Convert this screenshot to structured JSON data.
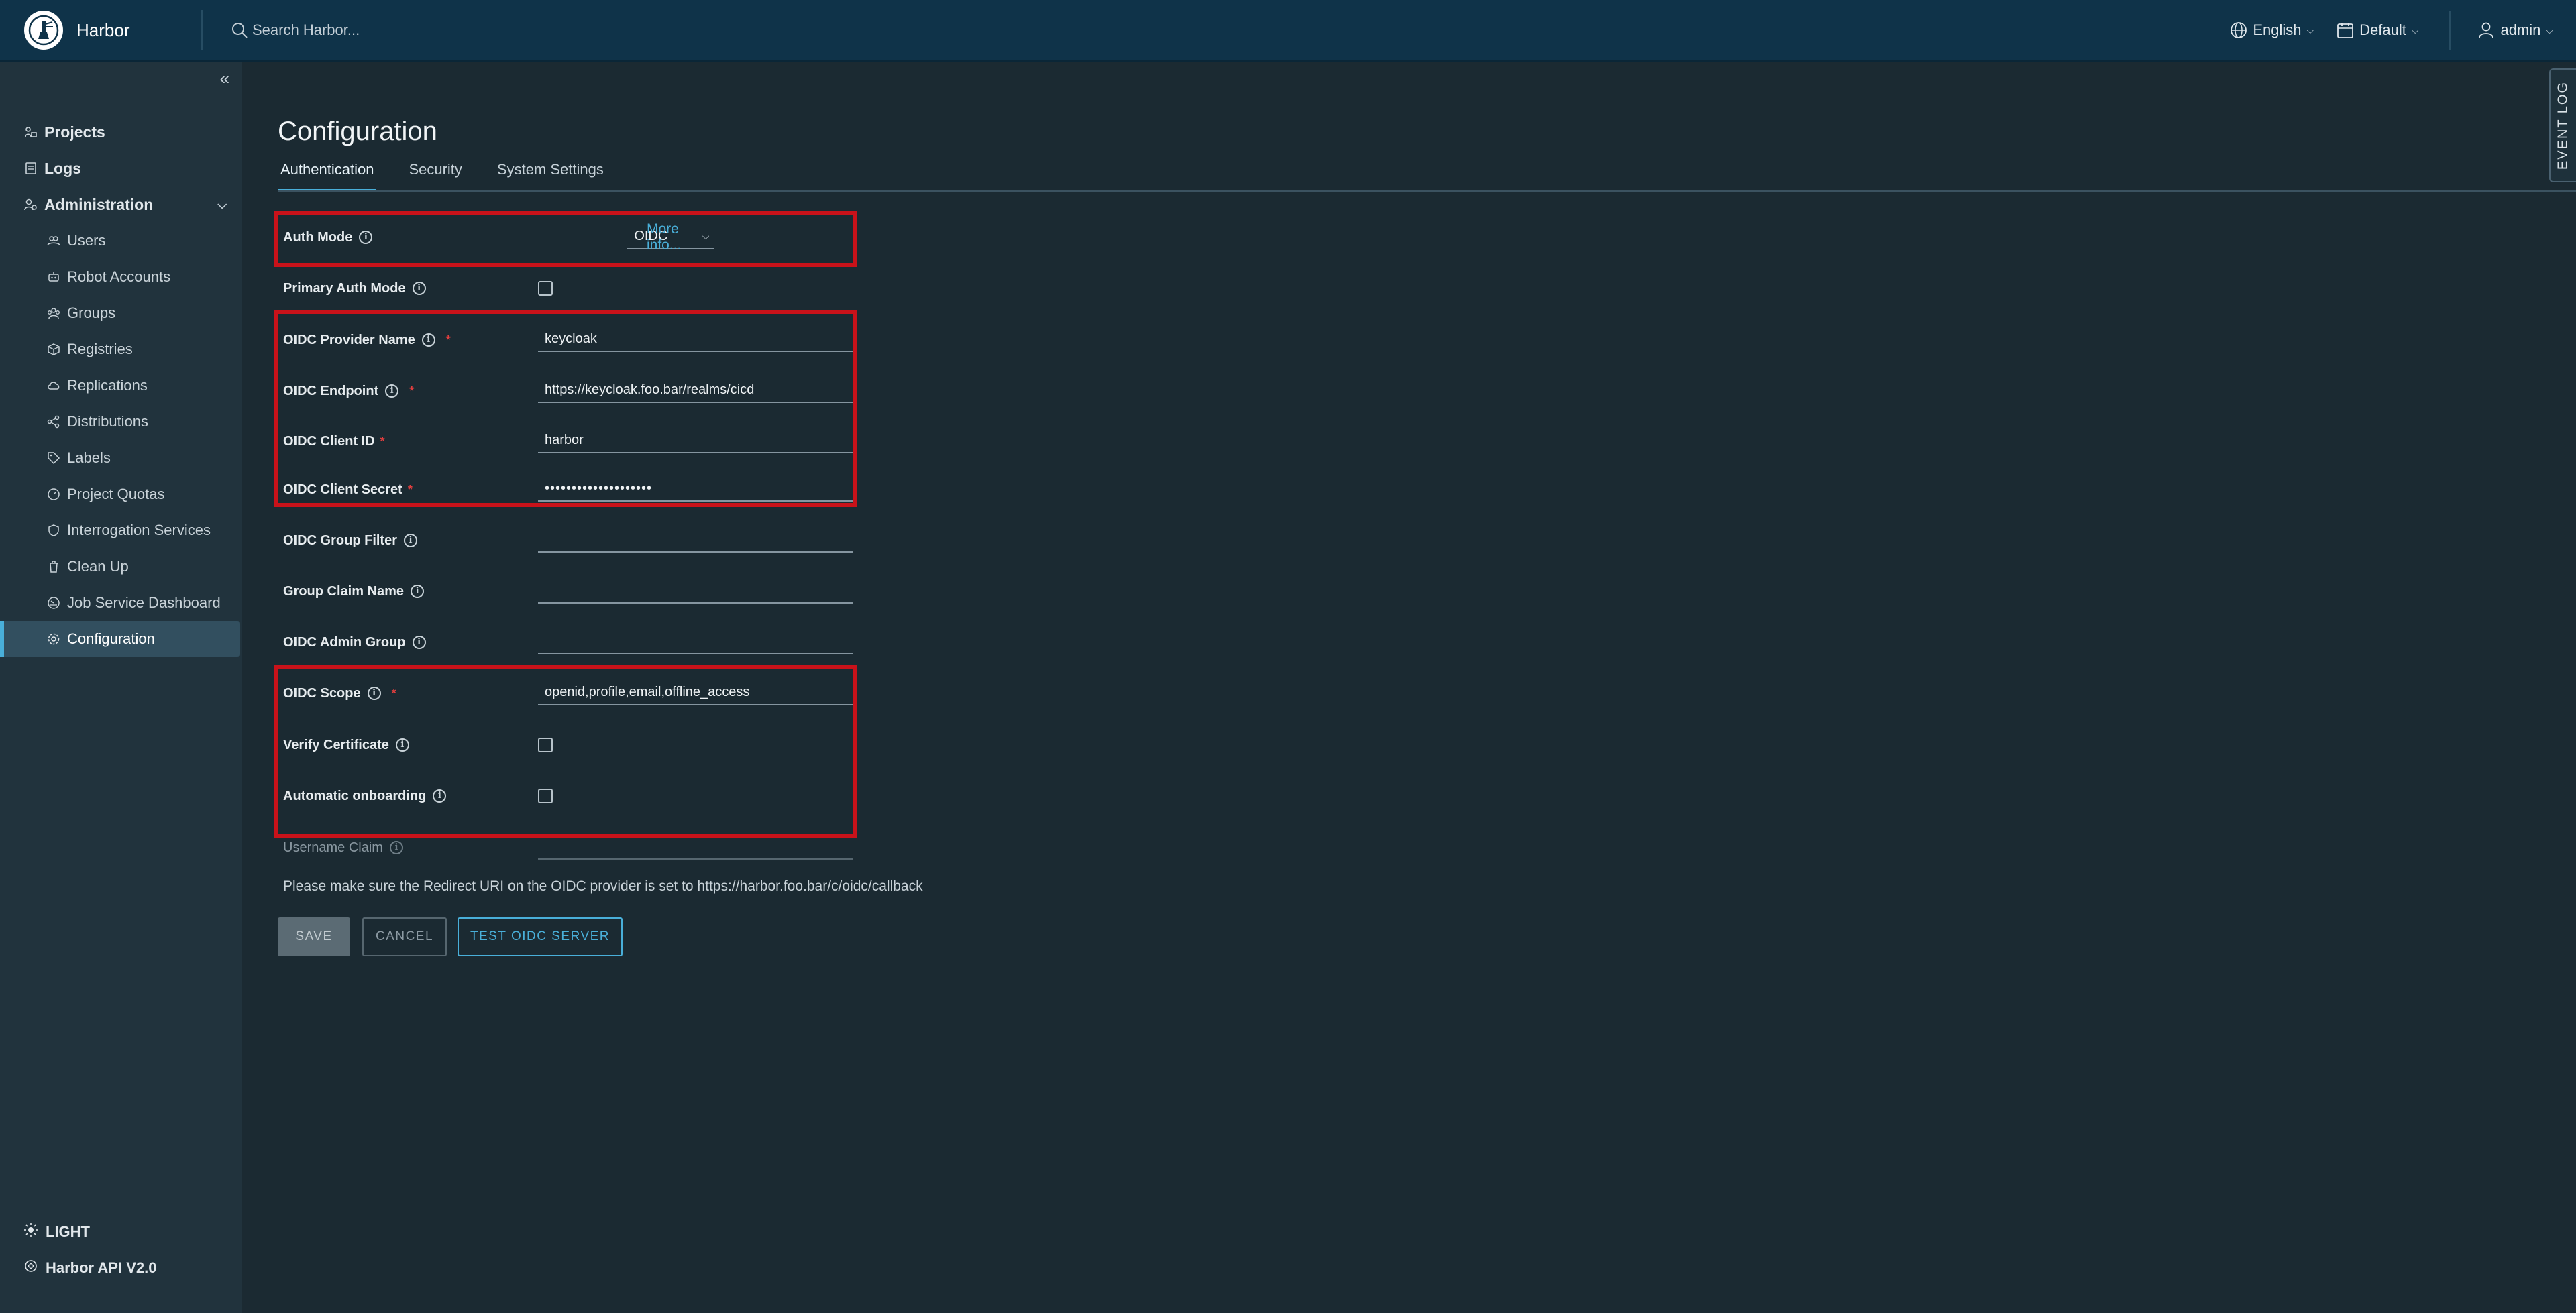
{
  "header": {
    "app_name": "Harbor",
    "search_placeholder": "Search Harbor...",
    "language": "English",
    "theme": "Default",
    "user": "admin"
  },
  "sidebar": {
    "items": [
      {
        "label": "Projects"
      },
      {
        "label": "Logs"
      },
      {
        "label": "Administration"
      }
    ],
    "admin_items": [
      {
        "label": "Users"
      },
      {
        "label": "Robot Accounts"
      },
      {
        "label": "Groups"
      },
      {
        "label": "Registries"
      },
      {
        "label": "Replications"
      },
      {
        "label": "Distributions"
      },
      {
        "label": "Labels"
      },
      {
        "label": "Project Quotas"
      },
      {
        "label": "Interrogation Services"
      },
      {
        "label": "Clean Up"
      },
      {
        "label": "Job Service Dashboard"
      },
      {
        "label": "Configuration"
      }
    ],
    "bottom": {
      "theme_toggle": "LIGHT",
      "api": "Harbor API V2.0"
    }
  },
  "main": {
    "title": "Configuration",
    "tabs": [
      {
        "label": "Authentication",
        "active": true
      },
      {
        "label": "Security"
      },
      {
        "label": "System Settings"
      }
    ],
    "event_log": "EVENT LOG",
    "form": {
      "auth_mode": {
        "label": "Auth Mode",
        "value": "OIDC",
        "more_info": "More info..."
      },
      "primary_auth_mode": {
        "label": "Primary Auth Mode",
        "checked": false
      },
      "oidc_provider_name": {
        "label": "OIDC Provider Name",
        "value": "keycloak"
      },
      "oidc_endpoint": {
        "label": "OIDC Endpoint",
        "value": "https://keycloak.foo.bar/realms/cicd"
      },
      "oidc_client_id": {
        "label": "OIDC Client ID",
        "value": "harbor"
      },
      "oidc_client_secret": {
        "label": "OIDC Client Secret",
        "value": "••••••••••••••••••••"
      },
      "oidc_group_filter": {
        "label": "OIDC Group Filter",
        "value": ""
      },
      "group_claim_name": {
        "label": "Group Claim Name",
        "value": ""
      },
      "oidc_admin_group": {
        "label": "OIDC Admin Group",
        "value": ""
      },
      "oidc_scope": {
        "label": "OIDC Scope",
        "value": "openid,profile,email,offline_access"
      },
      "verify_certificate": {
        "label": "Verify Certificate",
        "checked": false
      },
      "automatic_onboarding": {
        "label": "Automatic onboarding",
        "checked": false
      },
      "username_claim": {
        "label": "Username Claim",
        "value": ""
      }
    },
    "note": "Please make sure the Redirect URI on the OIDC provider is set to https://harbor.foo.bar/c/oidc/callback",
    "buttons": {
      "save": "SAVE",
      "cancel": "CANCEL",
      "test": "TEST OIDC SERVER"
    }
  },
  "colors": {
    "accent": "#49afd9",
    "highlight": "#c9121a",
    "required": "#e23e3e"
  }
}
